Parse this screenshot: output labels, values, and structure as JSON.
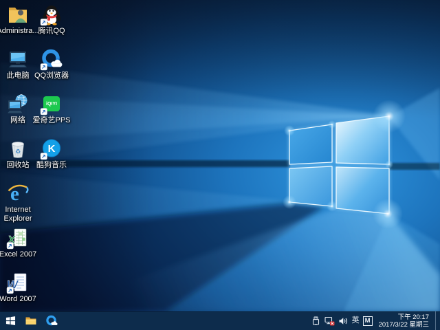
{
  "desktop": {
    "icons": [
      {
        "name": "administrator-folder",
        "label": "Administra..."
      },
      {
        "name": "tencent-qq",
        "label": "腾讯QQ"
      },
      {
        "name": "this-pc",
        "label": "此电脑"
      },
      {
        "name": "qq-browser",
        "label": "QQ浏览器"
      },
      {
        "name": "network",
        "label": "网络"
      },
      {
        "name": "iqiyi-pps",
        "label": "爱奇艺PPS"
      },
      {
        "name": "recycle-bin",
        "label": "回收站"
      },
      {
        "name": "kugou-music",
        "label": "酷狗音乐"
      },
      {
        "name": "internet-explorer",
        "label": "Internet Explorer"
      },
      {
        "name": "excel-2007",
        "label": "Excel 2007"
      },
      {
        "name": "word-2007",
        "label": "Word 2007"
      }
    ],
    "icon_art": {
      "iqiyi_logo": "iQIYI",
      "kugou_letter": "K",
      "ie_letter": "e",
      "excel_letter": "X",
      "word_letter": "W",
      "recycle_glyph": "♻"
    }
  },
  "taskbar": {
    "start_icon": "windows-logo",
    "pinned_icons": [
      "file-explorer",
      "qq-browser"
    ],
    "tray": {
      "icons": [
        "usb-device",
        "network-disconnected",
        "volume"
      ],
      "input_language": "英",
      "ime_mode": "M",
      "time": "下午 20:17",
      "date": "2017/3/22 星期三"
    }
  },
  "colors": {
    "wallpaper_base": "#0a1c38",
    "wallpaper_accent": "#2e94de",
    "taskbar": "#0d2c4c",
    "iqiyi_green": "#1dc94f",
    "kugou_blue": "#14a0e8",
    "excel_green": "#1e8c44",
    "word_blue": "#2b5ea7",
    "ie_blue": "#47aef5",
    "qq_scarf_red": "#e23c3c",
    "network_error_red": "#d63031"
  }
}
